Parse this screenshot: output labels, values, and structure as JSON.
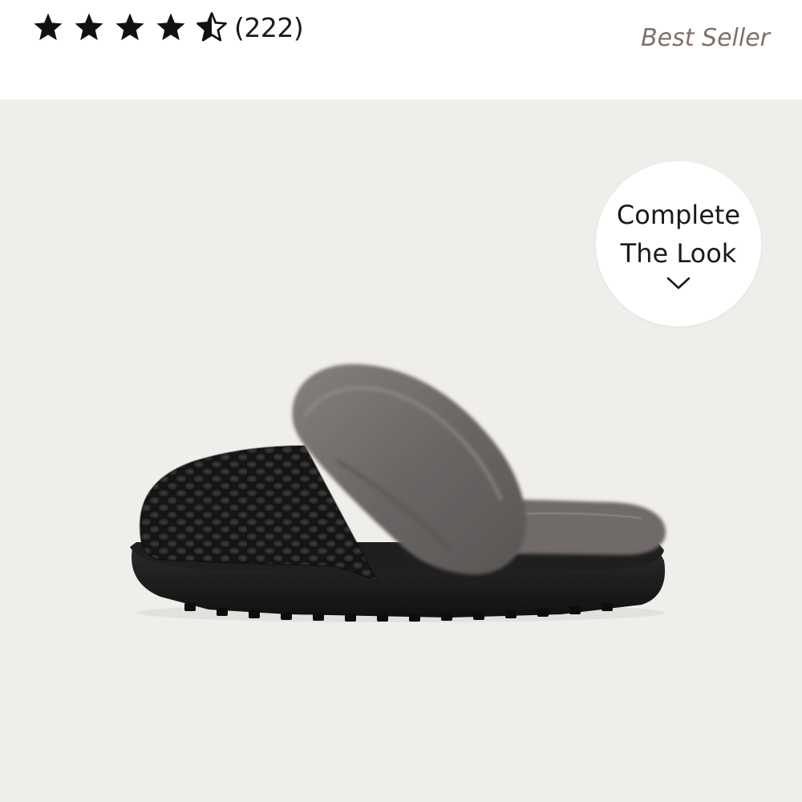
{
  "product": {
    "rating": {
      "value": 4.5,
      "max": 5,
      "stars": [
        "full",
        "full",
        "full",
        "full",
        "half"
      ],
      "count_label": "(222)"
    },
    "badge": "Best Seller",
    "image": {
      "icon": "slipper-product-image",
      "colors": {
        "knit": "#141414",
        "fur": "#6b6766",
        "sole": "#1c1c1c",
        "background": "#efeeea"
      }
    }
  },
  "complete_look": {
    "line1": "Complete",
    "line2": "The Look",
    "icon": "chevron-down-icon"
  }
}
